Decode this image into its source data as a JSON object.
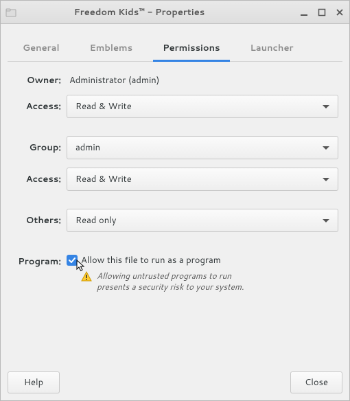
{
  "window": {
    "title": "Freedom Kids™ - Properties"
  },
  "tabs": {
    "general": "General",
    "emblems": "Emblems",
    "permissions": "Permissions",
    "launcher": "Launcher"
  },
  "labels": {
    "owner": "Owner:",
    "access": "Access:",
    "group": "Group:",
    "others": "Others:",
    "program": "Program:"
  },
  "values": {
    "owner": "Administrator (admin)",
    "owner_access": "Read & Write",
    "group": "admin",
    "group_access": "Read & Write",
    "others_access": "Read only"
  },
  "program": {
    "checkbox_label": "Allow this file to run as a program",
    "checked": true,
    "warning_line1": "Allowing untrusted programs to run",
    "warning_line2": "presents a security risk to your system."
  },
  "footer": {
    "help": "Help",
    "close": "Close"
  }
}
